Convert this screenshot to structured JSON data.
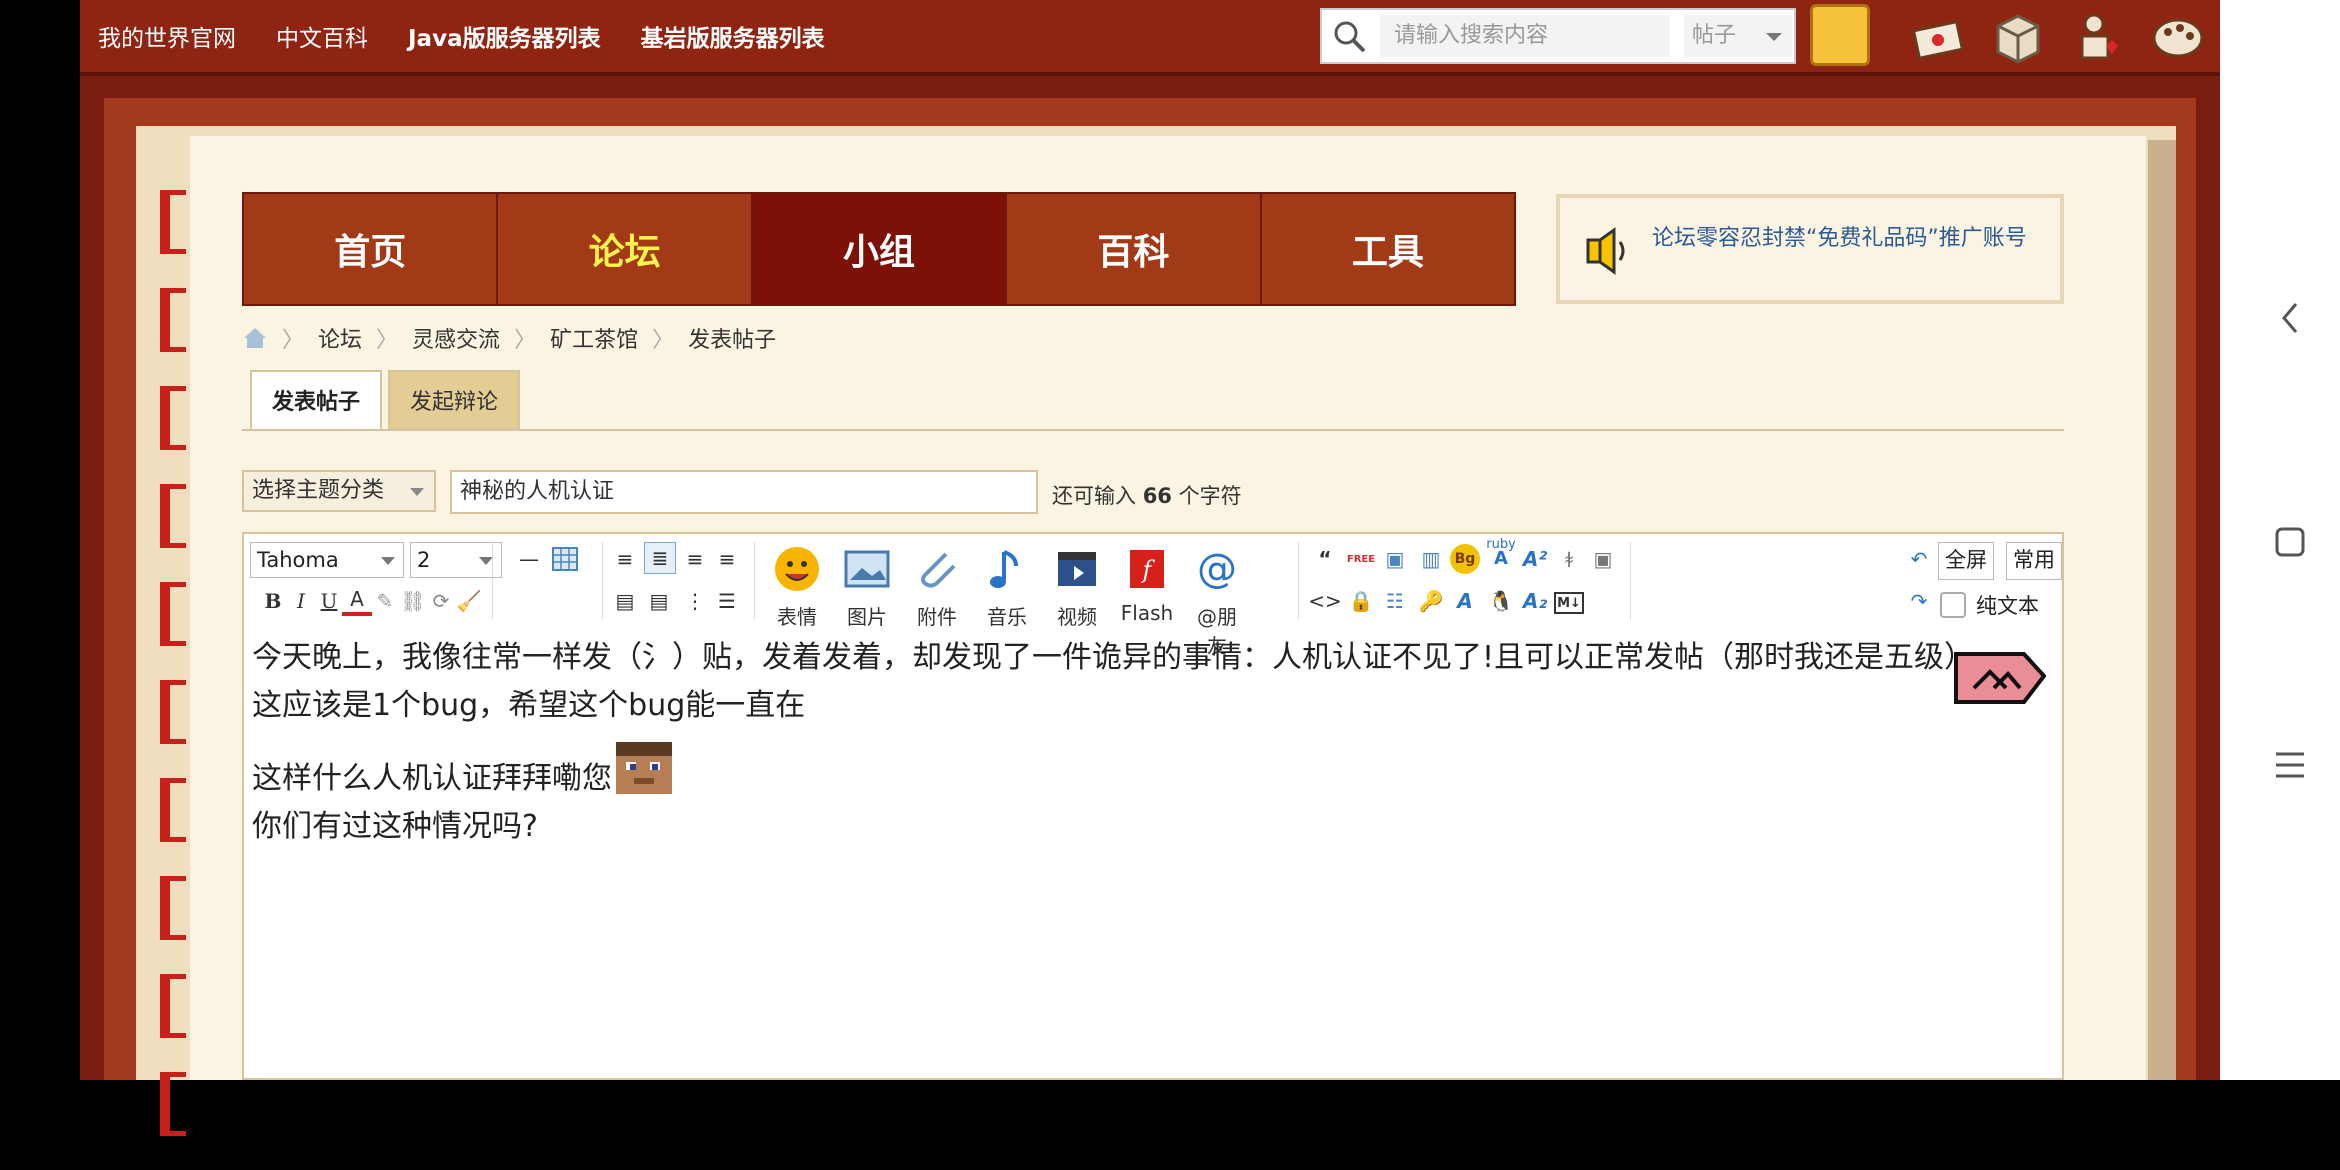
{
  "topbar": {
    "links": [
      "我的世界官网",
      "中文百科",
      "Java版服务器列表",
      "基岩版服务器列表"
    ],
    "search_placeholder": "请输入搜索内容",
    "search_scope": "帖子"
  },
  "nav": [
    "首页",
    "论坛",
    "小组",
    "百科",
    "工具"
  ],
  "notice": "论坛零容忍封禁“免费礼品码”推广账号",
  "breadcrumb": [
    "论坛",
    "灵感交流",
    "矿工茶馆",
    "发表帖子"
  ],
  "tabs": [
    "发表帖子",
    "发起辩论"
  ],
  "form": {
    "category": "选择主题分类",
    "title_value": "神秘的人机认证",
    "remaining_prefix": "还可输入",
    "remaining_count": "66",
    "remaining_suffix": "个字符"
  },
  "toolbar": {
    "font": "Tahoma",
    "size": "2",
    "tools": [
      "表情",
      "图片",
      "附件",
      "音乐",
      "视频",
      "Flash",
      "@朋友"
    ],
    "fullscreen": "全屏",
    "common": "常用",
    "plaintext": "纯文本",
    "quote_glyph": "“",
    "code_glyph": "<>",
    "ruby": "ruby",
    "free": "FREE",
    "bg": "Bg",
    "md": "M↓"
  },
  "post": {
    "line1": "今天晚上，我像往常一样发（氵）贴，发着发着，却发现了一件诡异的事情：人机认证不见了!且可以正常发帖（那时我还是五级）",
    "line2": "这应该是1个bug，希望这个bug能一直在",
    "line3": "这样什么人机认证拜拜嘞您",
    "line4": "你们有过这种情况吗?"
  }
}
